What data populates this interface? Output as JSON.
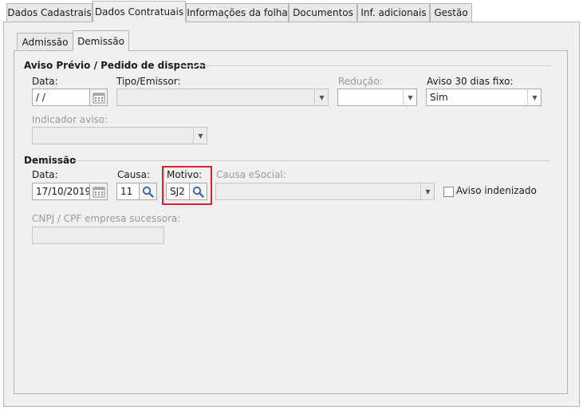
{
  "tabs": [
    {
      "label": "Dados Cadastrais",
      "active": false
    },
    {
      "label": "Dados Contratuais",
      "active": true
    },
    {
      "label": "Informações da folha",
      "active": false
    },
    {
      "label": "Documentos",
      "active": false
    },
    {
      "label": "Inf. adicionais",
      "active": false
    },
    {
      "label": "Gestão",
      "active": false
    }
  ],
  "subtabs": [
    {
      "label": "Admissão",
      "active": false
    },
    {
      "label": "Demissão",
      "active": true
    }
  ],
  "aviso": {
    "title": "Aviso Prévio / Pedido de dispensa",
    "data_label": "Data:",
    "data_value": " /  /",
    "tipo_label": "Tipo/Emissor:",
    "tipo_value": "",
    "reducao_label": "Redução:",
    "reducao_value": "",
    "aviso30_label": "Aviso 30 dias fixo:",
    "aviso30_value": "Sim",
    "indicador_label": "Indicador aviso:",
    "indicador_value": ""
  },
  "demissao": {
    "title": "Demissão",
    "data_label": "Data:",
    "data_value": "17/10/2019",
    "causa_label": "Causa:",
    "causa_value": "11",
    "motivo_label": "Motivo:",
    "motivo_value": "SJ2",
    "causa_esocial_label": "Causa eSocial:",
    "causa_esocial_value": "",
    "aviso_indenizado_label": "Aviso indenizado",
    "aviso_indenizado_checked": false,
    "cnpj_label": "CNPJ / CPF empresa sucessora:",
    "cnpj_value": ""
  },
  "colors": {
    "highlight": "#e0202a",
    "panel": "#f0f0f0",
    "icon_blue": "#3a6ea5"
  }
}
